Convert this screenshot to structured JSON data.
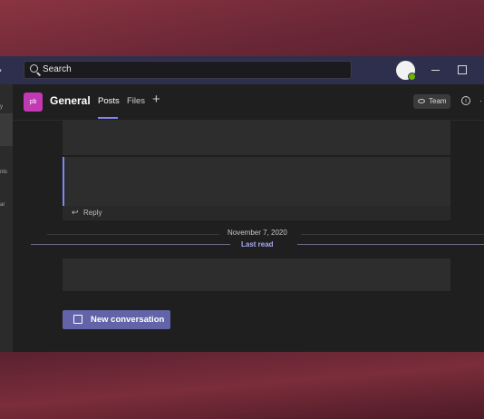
{
  "titlebar": {
    "search_placeholder": "Search"
  },
  "rail": {
    "items": [
      "y",
      "nts",
      "ar"
    ]
  },
  "channel": {
    "team_initials": "pb",
    "name": "General",
    "tabs": [
      "Posts",
      "Files"
    ],
    "add_tab_glyph": "+",
    "team_button_label": "Team",
    "info_glyph": "i",
    "more_glyph": "·"
  },
  "feed": {
    "reply_label": "Reply",
    "date_divider": "November 7, 2020",
    "last_read_label": "Last read",
    "new_conversation_label": "New conversation"
  },
  "colors": {
    "titlebar": "#2e2f4d",
    "accent": "#6264a7",
    "team_avatar": "#c239b3",
    "presence": "#6bb700"
  }
}
